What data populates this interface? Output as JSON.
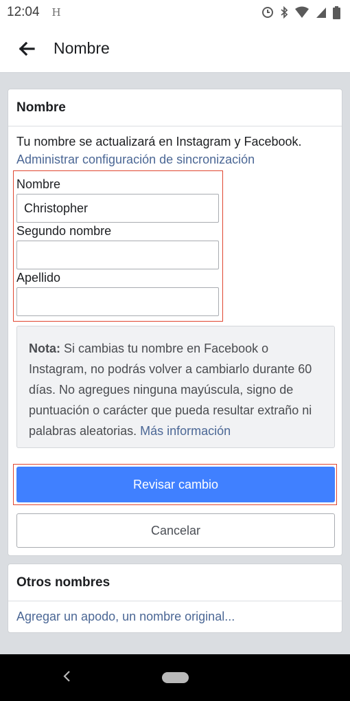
{
  "status_bar": {
    "time": "12:04",
    "notification_glyph": "H",
    "icons": [
      "sync-icon",
      "bluetooth-icon",
      "wifi-icon",
      "signal-icon",
      "battery-icon"
    ]
  },
  "app_bar": {
    "title": "Nombre"
  },
  "name_card": {
    "title": "Nombre",
    "sync_text": "Tu nombre se actualizará en Instagram y Facebook.",
    "sync_link": "Administrar configuración de sincronización",
    "fields": [
      {
        "label": "Nombre",
        "value": "Christopher"
      },
      {
        "label": "Segundo nombre",
        "value": ""
      },
      {
        "label": "Apellido",
        "value": ""
      }
    ],
    "note": {
      "bold": "Nota:",
      "text": " Si cambias tu nombre en Facebook o Instagram, no podrás volver a cambiarlo durante 60 días. No agregues ninguna mayúscula, signo de puntuación o carácter que pueda resultar extraño ni palabras aleatorias. ",
      "link": "Más información"
    },
    "review_button": "Revisar cambio",
    "cancel_button": "Cancelar"
  },
  "other_names_card": {
    "title": "Otros nombres",
    "link": "Agregar un apodo, un nombre original..."
  },
  "colors": {
    "primary": "#4080ff",
    "link": "#4b6795",
    "highlight": "#e0452f"
  }
}
